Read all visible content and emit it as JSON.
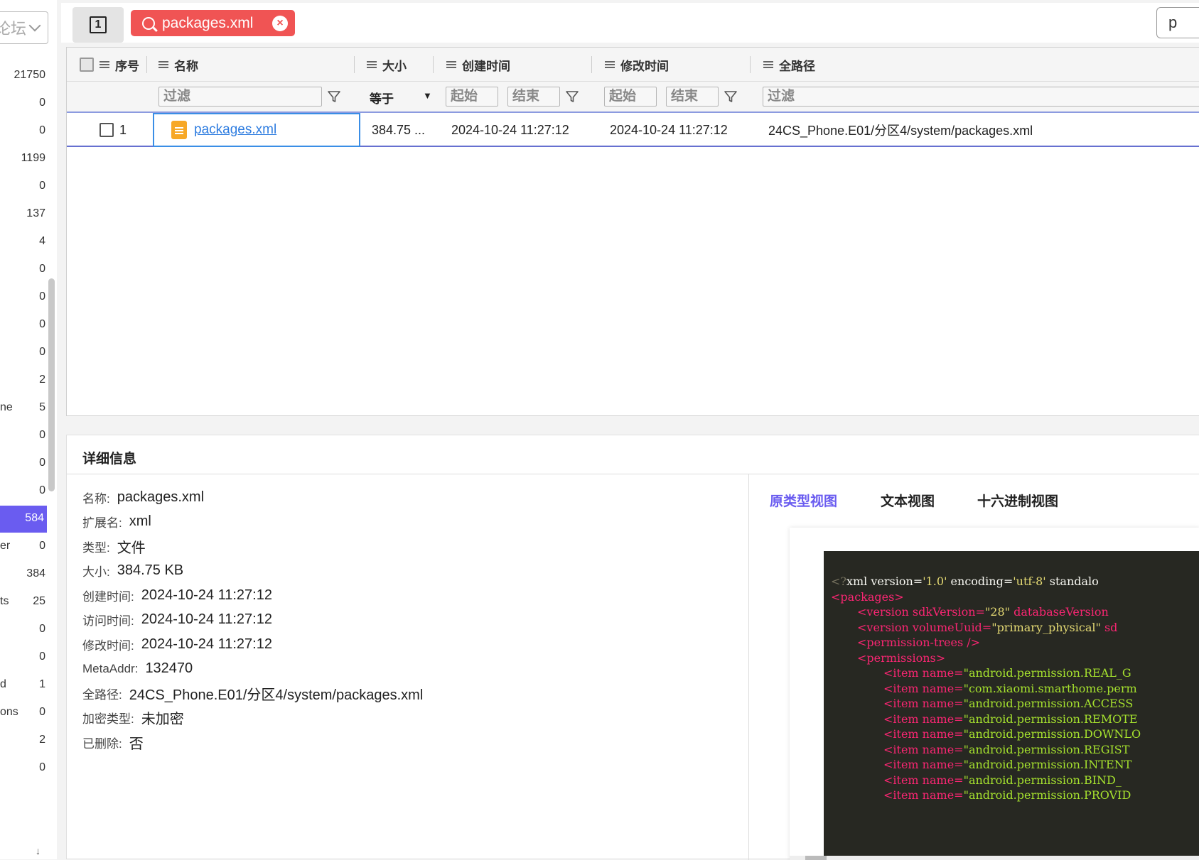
{
  "sidebar": {
    "dropdown_text": "论坛",
    "rows": [
      {
        "label": "",
        "count": "21750"
      },
      {
        "label": "",
        "count": "0"
      },
      {
        "label": "",
        "count": "0"
      },
      {
        "label": "",
        "count": "1199"
      },
      {
        "label": "",
        "count": "0"
      },
      {
        "label": "",
        "count": "137"
      },
      {
        "label": "",
        "count": "4"
      },
      {
        "label": "",
        "count": "0"
      },
      {
        "label": "",
        "count": "0"
      },
      {
        "label": "",
        "count": "0"
      },
      {
        "label": "",
        "count": "0"
      },
      {
        "label": "",
        "count": "2"
      },
      {
        "label": "ne",
        "count": "5"
      },
      {
        "label": "",
        "count": "0"
      },
      {
        "label": "",
        "count": "0"
      },
      {
        "label": "",
        "count": "0"
      },
      {
        "label": "",
        "count": "584"
      },
      {
        "label": "er",
        "count": "0"
      },
      {
        "label": "",
        "count": "384"
      },
      {
        "label": "ts",
        "count": "25"
      },
      {
        "label": "",
        "count": "0"
      },
      {
        "label": "",
        "count": "0"
      },
      {
        "label": "d",
        "count": "1"
      },
      {
        "label": "ons",
        "count": "0"
      },
      {
        "label": "",
        "count": "2"
      },
      {
        "label": "",
        "count": "0"
      }
    ],
    "active_index": 16
  },
  "topbar": {
    "page_number": "1",
    "search_tag": "packages.xml",
    "right_input_text": "p"
  },
  "table": {
    "headers": {
      "index": "序号",
      "name": "名称",
      "size": "大小",
      "created": "创建时间",
      "modified": "修改时间",
      "path": "全路径"
    },
    "filters": {
      "name_placeholder": "过滤",
      "size_op": "等于",
      "created_start": "起始",
      "created_end": "结束",
      "modified_start": "起始",
      "modified_end": "结束",
      "path_placeholder": "过滤"
    },
    "rows": [
      {
        "index": "1",
        "name": "packages.xml",
        "size": "384.75 ...",
        "created": "2024-10-24 11:27:12",
        "modified": "2024-10-24 11:27:12",
        "path": "24CS_Phone.E01/分区4/system/packages.xml"
      }
    ]
  },
  "detail": {
    "title": "详细信息",
    "fields": [
      {
        "key": "名称:",
        "value": "packages.xml"
      },
      {
        "key": "扩展名:",
        "value": "xml"
      },
      {
        "key": "类型:",
        "value": "文件"
      },
      {
        "key": "大小:",
        "value": "384.75 KB"
      },
      {
        "key": "创建时间:",
        "value": "2024-10-24 11:27:12"
      },
      {
        "key": "访问时间:",
        "value": "2024-10-24 11:27:12"
      },
      {
        "key": "修改时间:",
        "value": "2024-10-24 11:27:12"
      },
      {
        "key": "MetaAddr:",
        "value": "132470"
      },
      {
        "key": "全路径:",
        "value": "24CS_Phone.E01/分区4/system/packages.xml"
      },
      {
        "key": "加密类型:",
        "value": "未加密"
      },
      {
        "key": "已删除:",
        "value": "否"
      }
    ],
    "view_tabs": [
      "原类型视图",
      "文本视图",
      "十六进制视图"
    ],
    "active_tab": 0,
    "code_lines": [
      {
        "indent": 0,
        "parts": [
          [
            "dim",
            "<?"
          ],
          [
            "txt",
            "xml version="
          ],
          [
            "str",
            "'1.0'"
          ],
          [
            "txt",
            " encoding="
          ],
          [
            "str",
            "'utf-8'"
          ],
          [
            "txt",
            " standalo"
          ]
        ]
      },
      {
        "indent": 0,
        "parts": [
          [
            "tag",
            "<packages>"
          ]
        ]
      },
      {
        "indent": 1,
        "parts": [
          [
            "tag",
            "<version"
          ],
          [
            "tag",
            " sdkVersion="
          ],
          [
            "str",
            "\"28\""
          ],
          [
            "tag",
            " databaseVersion"
          ]
        ]
      },
      {
        "indent": 1,
        "parts": [
          [
            "tag",
            "<version"
          ],
          [
            "tag",
            " volumeUuid="
          ],
          [
            "str",
            "\"primary_physical\""
          ],
          [
            "tag",
            " sd"
          ]
        ]
      },
      {
        "indent": 1,
        "parts": [
          [
            "tag",
            "<permission-trees />"
          ]
        ]
      },
      {
        "indent": 1,
        "parts": [
          [
            "tag",
            "<permissions>"
          ]
        ]
      },
      {
        "indent": 2,
        "parts": [
          [
            "tag",
            "<item"
          ],
          [
            "tag",
            " name="
          ],
          [
            "attr",
            "\"android.permission.REAL_G"
          ]
        ]
      },
      {
        "indent": 2,
        "parts": [
          [
            "tag",
            "<item"
          ],
          [
            "tag",
            " name="
          ],
          [
            "attr",
            "\"com.xiaomi.smarthome.perm"
          ]
        ]
      },
      {
        "indent": 2,
        "parts": [
          [
            "tag",
            "<item"
          ],
          [
            "tag",
            " name="
          ],
          [
            "attr",
            "\"android.permission.ACCESS"
          ]
        ]
      },
      {
        "indent": 2,
        "parts": [
          [
            "tag",
            "<item"
          ],
          [
            "tag",
            " name="
          ],
          [
            "attr",
            "\"android.permission.REMOTE"
          ]
        ]
      },
      {
        "indent": 2,
        "parts": [
          [
            "tag",
            "<item"
          ],
          [
            "tag",
            " name="
          ],
          [
            "attr",
            "\"android.permission.DOWNLO"
          ]
        ]
      },
      {
        "indent": 2,
        "parts": [
          [
            "tag",
            "<item"
          ],
          [
            "tag",
            " name="
          ],
          [
            "attr",
            "\"android.permission.REGIST"
          ]
        ]
      },
      {
        "indent": 2,
        "parts": [
          [
            "tag",
            "<item"
          ],
          [
            "tag",
            " name="
          ],
          [
            "attr",
            "\"android.permission.INTENT"
          ]
        ]
      },
      {
        "indent": 2,
        "parts": [
          [
            "tag",
            "<item"
          ],
          [
            "tag",
            " name="
          ],
          [
            "attr",
            "\"android.permission.BIND_"
          ]
        ]
      },
      {
        "indent": 2,
        "parts": [
          [
            "tag",
            "<item"
          ],
          [
            "tag",
            " name="
          ],
          [
            "attr",
            "\"android.permission.PROVID"
          ]
        ]
      }
    ]
  }
}
